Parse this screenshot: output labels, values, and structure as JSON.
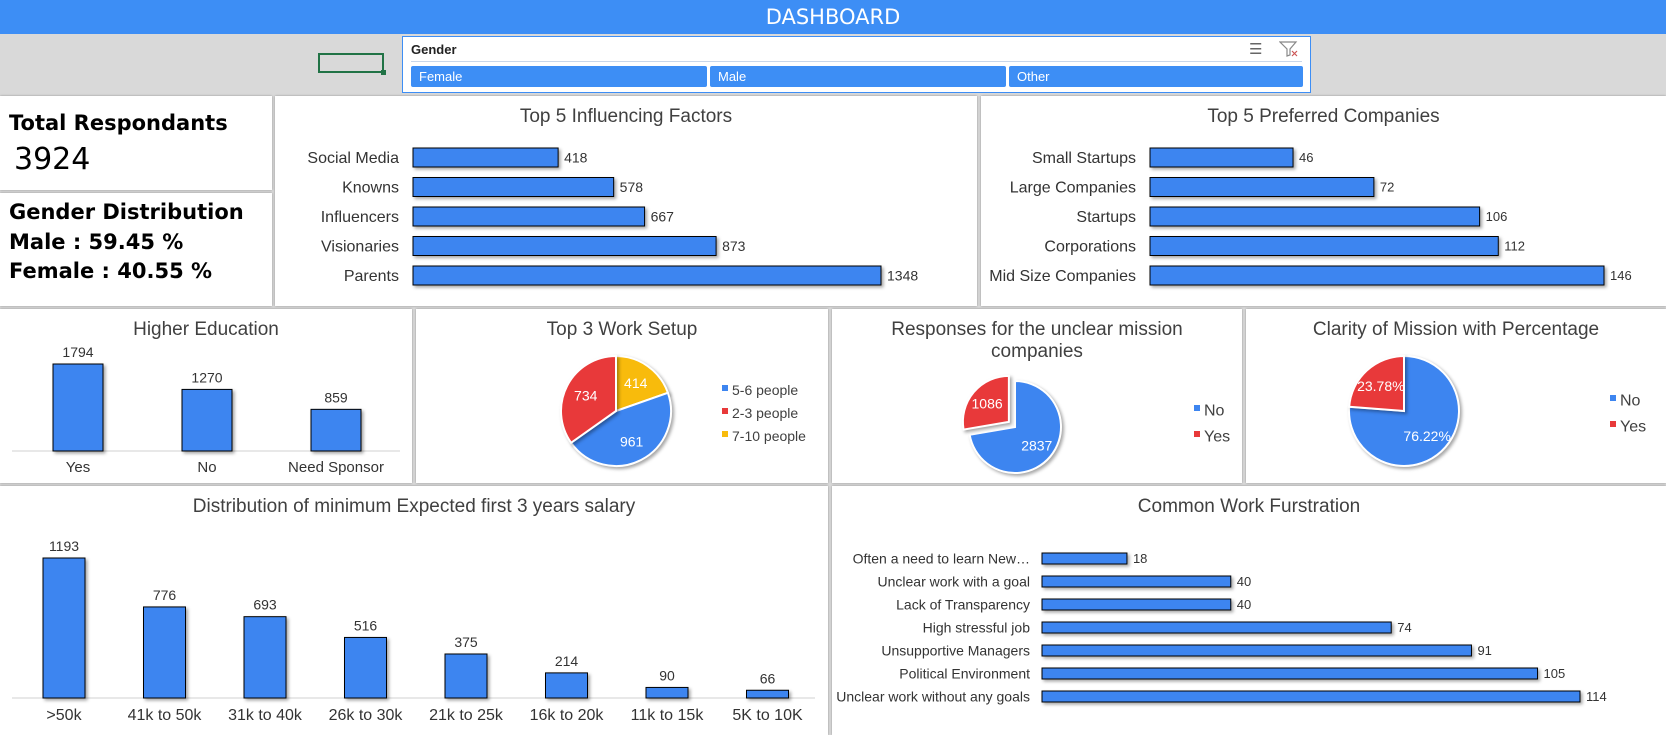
{
  "header": {
    "title": "DASHBOARD"
  },
  "slicer": {
    "title": "Gender",
    "multiselect_icon": "multiselect-icon",
    "clear_filter_icon": "clear-filter-icon",
    "items": [
      "Female",
      "Male",
      "Other"
    ],
    "color": "#3d8ef5"
  },
  "kpis": {
    "total_label": "Total Respondants",
    "total_value": "3924",
    "gender_title": "Gender Distribution",
    "male_text": "Male : 59.45 %",
    "female_text": "Female : 40.55 %"
  },
  "colors": {
    "blue": "#3d85f0",
    "red": "#e8393a",
    "yellow": "#f8bb0c"
  },
  "chart_data": [
    {
      "id": "influencing",
      "type": "bar",
      "orientation": "horizontal",
      "title": "Top 5 Influencing Factors",
      "categories": [
        "Social Media",
        "Knowns",
        "Influencers",
        "Visionaries",
        "Parents"
      ],
      "values": [
        418,
        578,
        667,
        873,
        1348
      ]
    },
    {
      "id": "companies",
      "type": "bar",
      "orientation": "horizontal",
      "title": "Top 5 Preferred Companies",
      "categories": [
        "Small Startups",
        "Large Companies",
        "Startups",
        "Corporations",
        "Mid Size Companies"
      ],
      "values": [
        46,
        72,
        106,
        112,
        146
      ]
    },
    {
      "id": "education",
      "type": "bar",
      "title": "Higher Education",
      "categories": [
        "Yes",
        "No",
        "Need Sponsor"
      ],
      "values": [
        1794,
        1270,
        859
      ]
    },
    {
      "id": "worksetup",
      "type": "pie",
      "title": "Top 3 Work Setup",
      "categories": [
        "5-6 people",
        "2-3 people",
        "7-10 people"
      ],
      "values": [
        961,
        734,
        414
      ],
      "legend": "right"
    },
    {
      "id": "unclear",
      "type": "pie",
      "title": "Responses for the unclear mission companies",
      "categories": [
        "No",
        "Yes"
      ],
      "values": [
        2837,
        1086
      ],
      "exploded": "Yes",
      "legend": "right"
    },
    {
      "id": "clarity",
      "type": "pie",
      "title": "Clarity of Mission with Percentage",
      "categories": [
        "No",
        "Yes"
      ],
      "values": [
        76.22,
        23.78
      ],
      "labels": [
        "76.22%",
        "23.78%"
      ],
      "legend": "right"
    },
    {
      "id": "salary",
      "type": "bar",
      "title": "Distribution of minimum Expected first 3 years salary",
      "categories": [
        ">50k",
        "41k to 50k",
        "31k to 40k",
        "26k to 30k",
        "21k to 25k",
        "16k to 20k",
        "11k to 15k",
        "5K to 10K"
      ],
      "values": [
        1193,
        776,
        693,
        516,
        375,
        214,
        90,
        66
      ]
    },
    {
      "id": "frustration",
      "type": "bar",
      "orientation": "horizontal",
      "title": "Common Work Furstration",
      "categories": [
        "Often a need to learn New…",
        "Unclear work with a goal",
        "Lack of Transparency",
        "High stressful job",
        "Unsupportive Managers",
        "Political Environment",
        "Unclear work without any goals"
      ],
      "values": [
        18,
        40,
        40,
        74,
        91,
        105,
        114
      ]
    }
  ]
}
